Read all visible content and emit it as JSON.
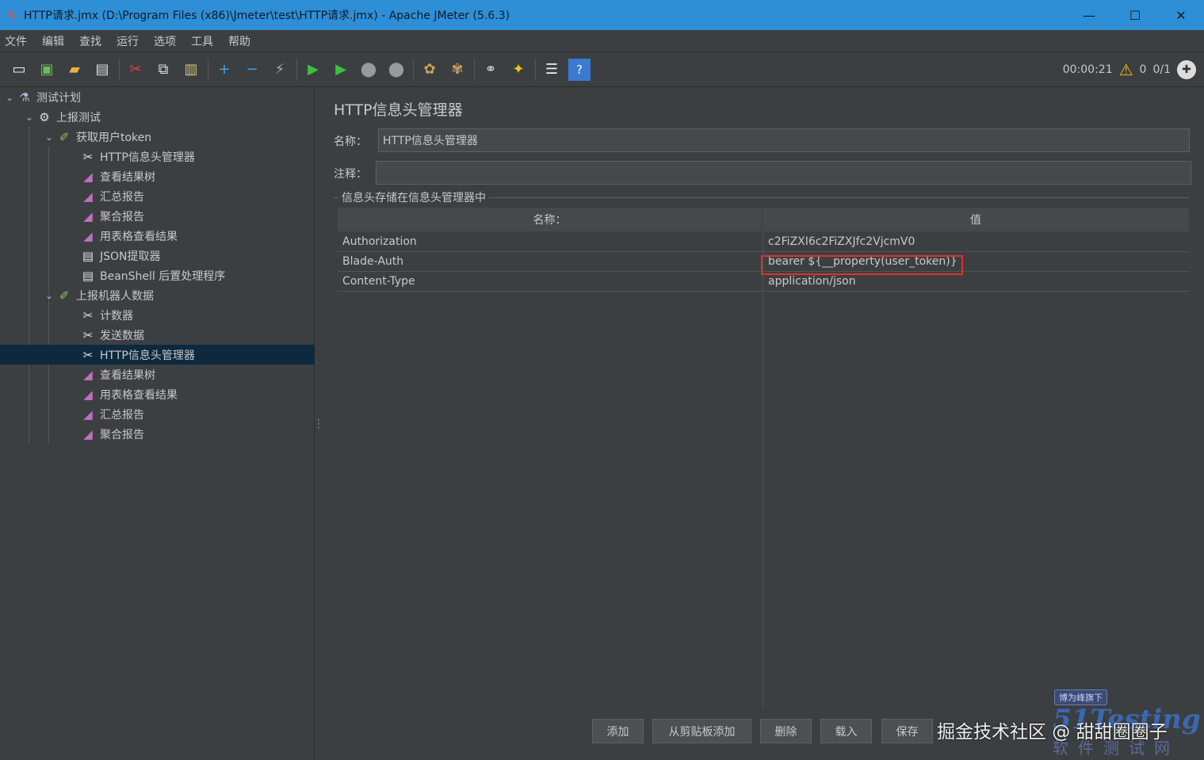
{
  "window": {
    "title": "HTTP请求.jmx (D:\\Program Files (x86)\\Jmeter\\test\\HTTP请求.jmx) - Apache JMeter (5.6.3)",
    "minimize": "—",
    "maximize": "☐",
    "close": "✕"
  },
  "menu": [
    "文件",
    "编辑",
    "查找",
    "运行",
    "选项",
    "工具",
    "帮助"
  ],
  "toolbar": {
    "elapsed": "00:00:21",
    "warning_count": "0",
    "threads": "0/1"
  },
  "tree": [
    {
      "label": "测试计划",
      "icon": "plan-icon",
      "level": 0,
      "expanded": true
    },
    {
      "label": "上报测试",
      "icon": "gear-icon",
      "level": 1,
      "expanded": true
    },
    {
      "label": "获取用户token",
      "icon": "sampler-icon",
      "level": 2,
      "expanded": true
    },
    {
      "label": "HTTP信息头管理器",
      "icon": "config-icon",
      "level": 3
    },
    {
      "label": "查看结果树",
      "icon": "report-icon",
      "level": 3
    },
    {
      "label": "汇总报告",
      "icon": "report-icon",
      "level": 3
    },
    {
      "label": "聚合报告",
      "icon": "report-icon",
      "level": 3
    },
    {
      "label": "用表格查看结果",
      "icon": "report-icon",
      "level": 3
    },
    {
      "label": "JSON提取器",
      "icon": "doc-icon",
      "level": 3
    },
    {
      "label": "BeanShell 后置处理程序",
      "icon": "doc-icon",
      "level": 3
    },
    {
      "label": "上报机器人数据",
      "icon": "sampler-icon",
      "level": 2,
      "expanded": true
    },
    {
      "label": "计数器",
      "icon": "config-icon",
      "level": 3
    },
    {
      "label": "发送数据",
      "icon": "config-icon",
      "level": 3
    },
    {
      "label": "HTTP信息头管理器",
      "icon": "config-icon",
      "level": 3,
      "selected": true
    },
    {
      "label": "查看结果树",
      "icon": "report-icon",
      "level": 3
    },
    {
      "label": "用表格查看结果",
      "icon": "report-icon",
      "level": 3
    },
    {
      "label": "汇总报告",
      "icon": "report-icon",
      "level": 3
    },
    {
      "label": "聚合报告",
      "icon": "report-icon",
      "level": 3
    }
  ],
  "panel": {
    "title": "HTTP信息头管理器",
    "name_label": "名称：",
    "name_value": "HTTP信息头管理器",
    "comment_label": "注释：",
    "comment_value": "",
    "group_label": "信息头存储在信息头管理器中",
    "columns": [
      "名称：",
      "值"
    ],
    "rows": [
      {
        "name": "Authorization",
        "value": "c2FiZXI6c2FiZXJfc2VjcmV0"
      },
      {
        "name": "Blade-Auth",
        "value": "bearer ${__property(user_token)}"
      },
      {
        "name": "Content-Type",
        "value": "application/json"
      }
    ],
    "buttons": [
      "添加",
      "从剪贴板添加",
      "删除",
      "载入",
      "保存"
    ]
  },
  "watermark": {
    "text": "掘金技术社区 @ 甜甜圈圈子",
    "logo_tag": "博为峰旗下",
    "logo_main": "51Testing",
    "logo_sub": "软件测试网"
  },
  "colors": {
    "background": "#3c3f41",
    "titlebar": "#2f8fd6",
    "selected": "#0d293e",
    "highlight": "#e0302a"
  }
}
